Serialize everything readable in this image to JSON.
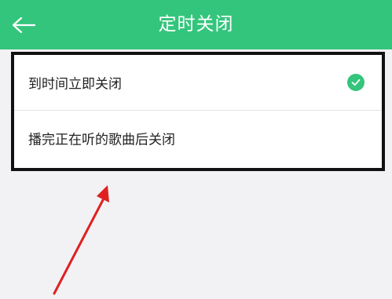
{
  "header": {
    "title": "定时关闭",
    "back_icon": "arrow-left-icon",
    "background": "#34c57c"
  },
  "options": [
    {
      "label": "到时间立即关闭",
      "selected": true
    },
    {
      "label": "播完正在听的歌曲后关闭",
      "selected": false
    }
  ],
  "colors": {
    "accent": "#34c57c",
    "page_background": "#f2f2f4",
    "annotation_box": "#111111",
    "annotation_arrow": "#e02020"
  },
  "annotation": {
    "type": "highlight-box-with-arrow"
  }
}
